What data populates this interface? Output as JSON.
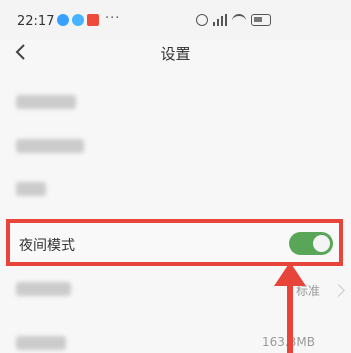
{
  "status_bar": {
    "time": "22:17",
    "more": "···",
    "icons": [
      "alarm-icon",
      "signal-icon",
      "wifi-icon",
      "battery-icon"
    ]
  },
  "header": {
    "back_icon": "chevron-left-icon",
    "title": "设置"
  },
  "rows": [
    {
      "label": "",
      "blurred": true
    },
    {
      "label": "",
      "blurred": true
    },
    {
      "label": "",
      "blurred": true
    },
    {
      "label": "夜间模式",
      "toggle_on": true,
      "highlighted": true
    },
    {
      "label": "",
      "blurred": true,
      "value": "标准"
    },
    {
      "label": "",
      "blurred": true,
      "value": "163.3MB"
    }
  ],
  "colors": {
    "highlight": "#e8453a",
    "toggle_on": "#5aa658",
    "arrow": "#e8453a"
  }
}
